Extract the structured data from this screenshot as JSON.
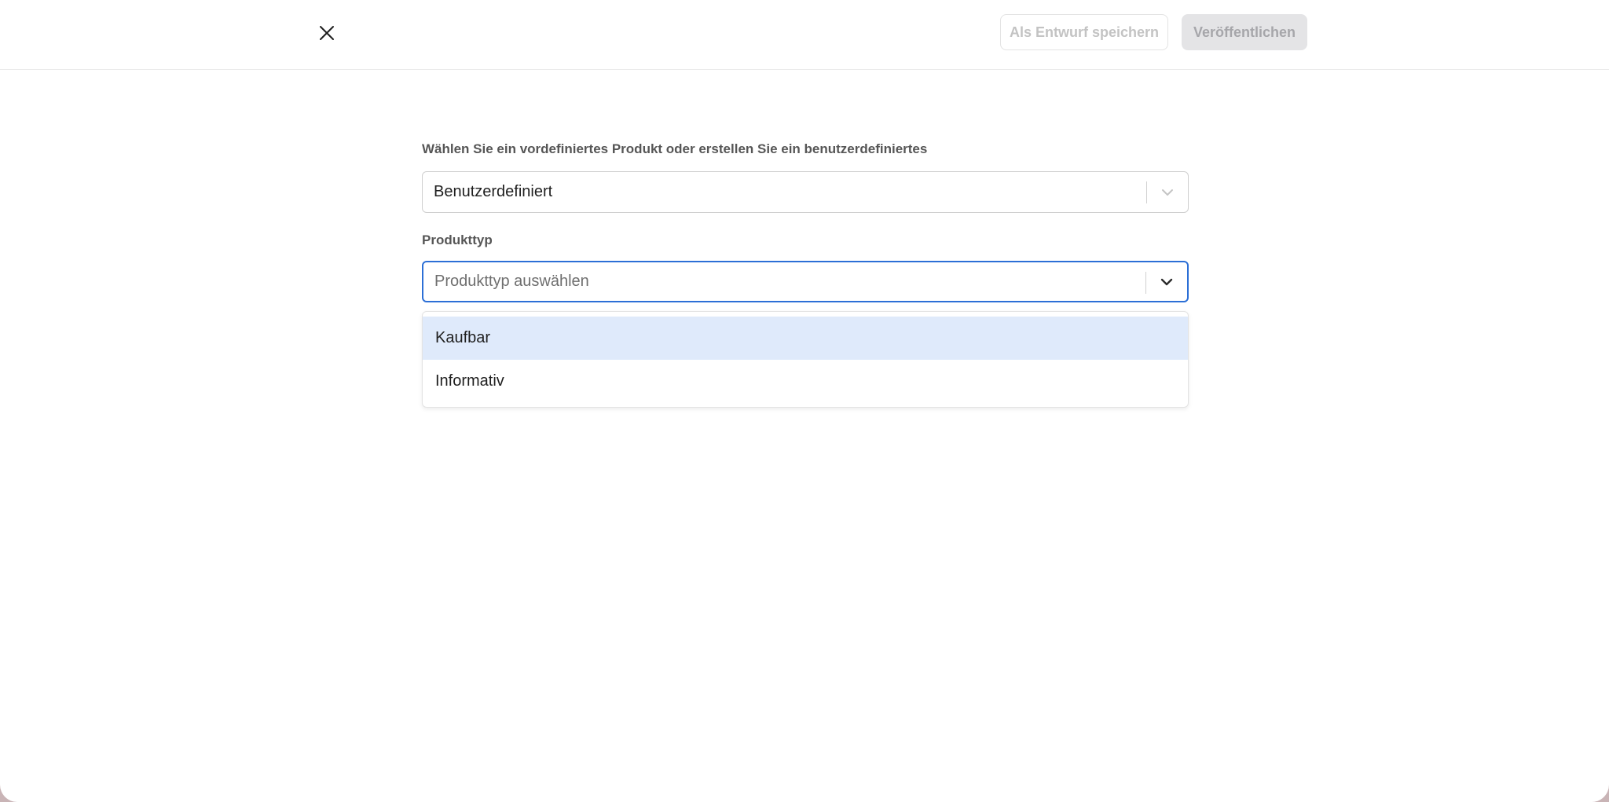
{
  "header": {
    "save_draft_label": "Als Entwurf speichern",
    "publish_label": "Veröffentlichen"
  },
  "form": {
    "product_field": {
      "label": "Wählen Sie ein vordefiniertes Produkt oder erstellen Sie ein benutzerdefiniertes",
      "value": "Benutzerdefiniert"
    },
    "type_field": {
      "label": "Produkttyp",
      "placeholder": "Produkttyp auswählen",
      "options": [
        {
          "label": "Kaufbar",
          "highlighted": true
        },
        {
          "label": "Informativ",
          "highlighted": false
        }
      ]
    }
  },
  "colors": {
    "focus_border": "#2c6fd6",
    "option_highlight": "#dfeafb",
    "publish_disabled_bg": "#e4e4e6"
  }
}
